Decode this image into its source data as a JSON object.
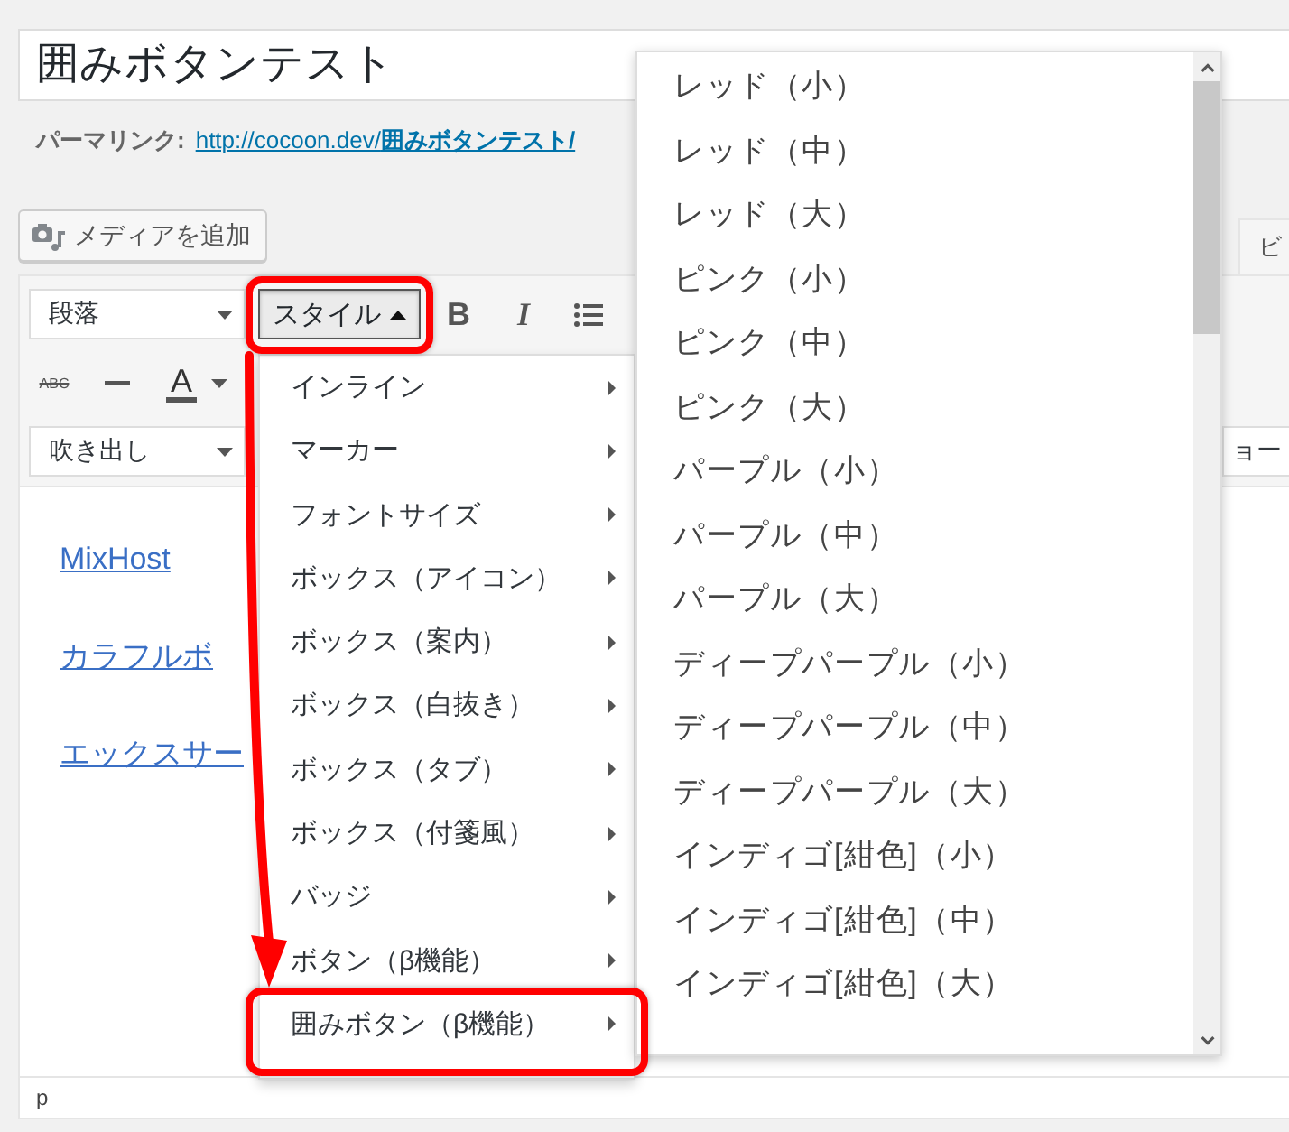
{
  "post_title": {
    "value": "囲みボタンテスト"
  },
  "permalink": {
    "label": "パーマリンク:",
    "url": "http://cocoon.dev/**囲みボタンテスト/**"
  },
  "media_button": {
    "label": "メディアを追加"
  },
  "editor_tabs": [
    {
      "label": "ビ",
      "selected": true
    }
  ],
  "toolbar": {
    "rows": [
      {
        "items": [
          {
            "kind": "select",
            "value": "段落"
          },
          {
            "kind": "menu_button",
            "label": "スタイル",
            "open": true,
            "highlighted": true
          },
          {
            "kind": "bold",
            "text": "B"
          },
          {
            "kind": "italic",
            "text": "I"
          },
          {
            "kind": "bullet_list"
          }
        ]
      },
      {
        "items": [
          {
            "kind": "strike",
            "text": "ABC"
          },
          {
            "kind": "horizontal_line"
          },
          {
            "kind": "text_color",
            "text": "A"
          }
        ]
      },
      {
        "items": [
          {
            "kind": "select",
            "value": "吹き出し"
          }
        ],
        "trailing": [
          {
            "kind": "select",
            "value": "ョー"
          }
        ]
      }
    ]
  },
  "content": {
    "links": [
      {
        "text": "MixHost"
      },
      {
        "text": "カラフルボ"
      },
      {
        "text": "エックスサー"
      }
    ]
  },
  "status_bar": {
    "path": "p"
  },
  "style_menu": {
    "items": [
      {
        "label": "インライン",
        "has_submenu": true,
        "selected": false
      },
      {
        "label": "マーカー",
        "has_submenu": true,
        "selected": false
      },
      {
        "label": "フォントサイズ",
        "has_submenu": true,
        "selected": false
      },
      {
        "label": "ボックス（アイコン）",
        "has_submenu": true,
        "selected": false
      },
      {
        "label": "ボックス（案内）",
        "has_submenu": true,
        "selected": false
      },
      {
        "label": "ボックス（白抜き）",
        "has_submenu": true,
        "selected": false
      },
      {
        "label": "ボックス（タブ）",
        "has_submenu": true,
        "selected": false
      },
      {
        "label": "ボックス（付箋風）",
        "has_submenu": true,
        "selected": false
      },
      {
        "label": "バッジ",
        "has_submenu": true,
        "selected": false
      },
      {
        "label": "ボタン（β機能）",
        "has_submenu": true,
        "selected": false
      },
      {
        "label": "囲みボタン（β機能）",
        "has_submenu": true,
        "selected": true
      }
    ]
  },
  "submenu": {
    "items": [
      {
        "label": "レッド（小）"
      },
      {
        "label": "レッド（中）"
      },
      {
        "label": "レッド（大）"
      },
      {
        "label": "ピンク（小）"
      },
      {
        "label": "ピンク（中）"
      },
      {
        "label": "ピンク（大）"
      },
      {
        "label": "パープル（小）"
      },
      {
        "label": "パープル（中）"
      },
      {
        "label": "パープル（大）"
      },
      {
        "label": "ディープパープル（小）"
      },
      {
        "label": "ディープパープル（中）"
      },
      {
        "label": "ディープパープル（大）"
      },
      {
        "label": "インディゴ[紺色]（小）"
      },
      {
        "label": "インディゴ[紺色]（中）"
      },
      {
        "label": "インディゴ[紺色]（大）"
      }
    ]
  }
}
